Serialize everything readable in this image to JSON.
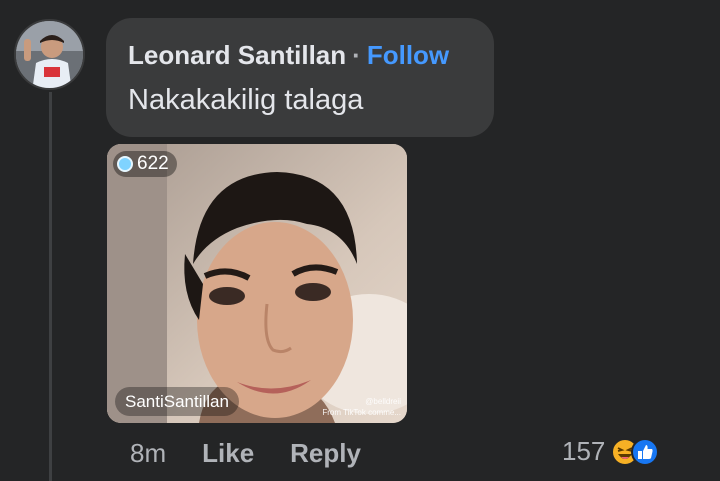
{
  "comment": {
    "author": "Leonard Santillan",
    "separator": "·",
    "follow_label": "Follow",
    "text": "Nakakakilig talaga"
  },
  "media": {
    "viewer_count": "622",
    "host_name": "SantiSantillan",
    "watermark_user": "@belldreii",
    "watermark_source": "From TikTok comme..."
  },
  "actions": {
    "time": "8m",
    "like_label": "Like",
    "reply_label": "Reply"
  },
  "reactions": {
    "count": "157",
    "types": [
      "haha-icon",
      "like-icon"
    ]
  },
  "colors": {
    "background": "#242526",
    "bubble": "#3a3b3c",
    "follow": "#4599ff",
    "like_reaction": "#1877f2",
    "haha_reaction": "#f7b125"
  }
}
